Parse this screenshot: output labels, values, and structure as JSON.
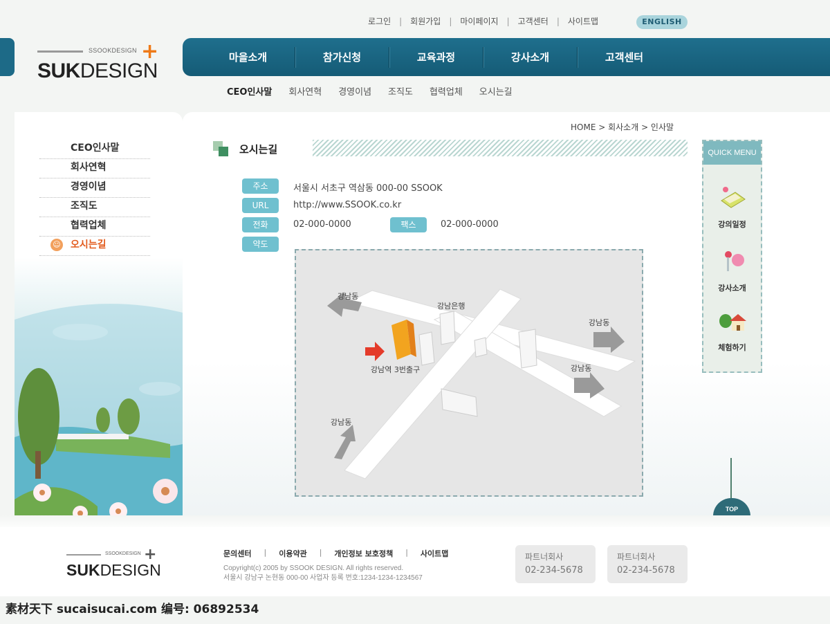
{
  "utility": {
    "items": [
      "로그인",
      "회원가입",
      "마이페이지",
      "고객센터",
      "사이트맵"
    ],
    "english": "ENGLISH"
  },
  "logo": {
    "small": "SSOOKDESIGN",
    "brand_bold": "SUK",
    "brand_rest": "DESIGN"
  },
  "mainnav": [
    "마을소개",
    "참가신청",
    "교육과정",
    "강사소개",
    "고객센터"
  ],
  "subnav": [
    "CEO인사말",
    "회사연혁",
    "경영이념",
    "조직도",
    "협력업체",
    "오시는길"
  ],
  "sidebar": {
    "items": [
      "CEO인사말",
      "회사연혁",
      "경영이념",
      "조직도",
      "협력업체",
      "오시는길"
    ],
    "active": "오시는길"
  },
  "breadcrumb": "HOME > 회사소개 > 인사말",
  "section_title": "오시는길",
  "info": {
    "address_label": "주소",
    "address": "서울시 서초구 역삼동 000-00 SSOOK",
    "url_label": "URL",
    "url": "http://www.SSOOK.co.kr",
    "phone_label": "전화",
    "phone": "02-000-0000",
    "fax_label": "팩스",
    "fax": "02-000-0000",
    "map_label": "약도"
  },
  "map": {
    "labels": [
      "강남동",
      "강남은행",
      "강남동",
      "강남역 3번출구",
      "강남동",
      "강남동"
    ]
  },
  "quick_menu": {
    "title": "QUICK MENU",
    "items": [
      "강의일정",
      "강사소개",
      "체험하기"
    ]
  },
  "top_button": "TOP",
  "footer": {
    "logo_small": "SSOOKDESIGN",
    "links": [
      "문의센터",
      "이용약관",
      "개인정보 보호정책",
      "사이트맵"
    ],
    "copyright": "Copyright(c) 2005 by SSOOK DESIGN. All rights reserved.",
    "address": "서울시 강남구 논현동 000-00  사업자 등록 번호:1234-1234-1234567",
    "partners": [
      {
        "label": "파트너회사",
        "phone": "02-234-5678"
      },
      {
        "label": "파트너회사",
        "phone": "02-234-5678"
      }
    ]
  },
  "watermark": "素材天下 sucaisucai.com  编号: 06892534"
}
